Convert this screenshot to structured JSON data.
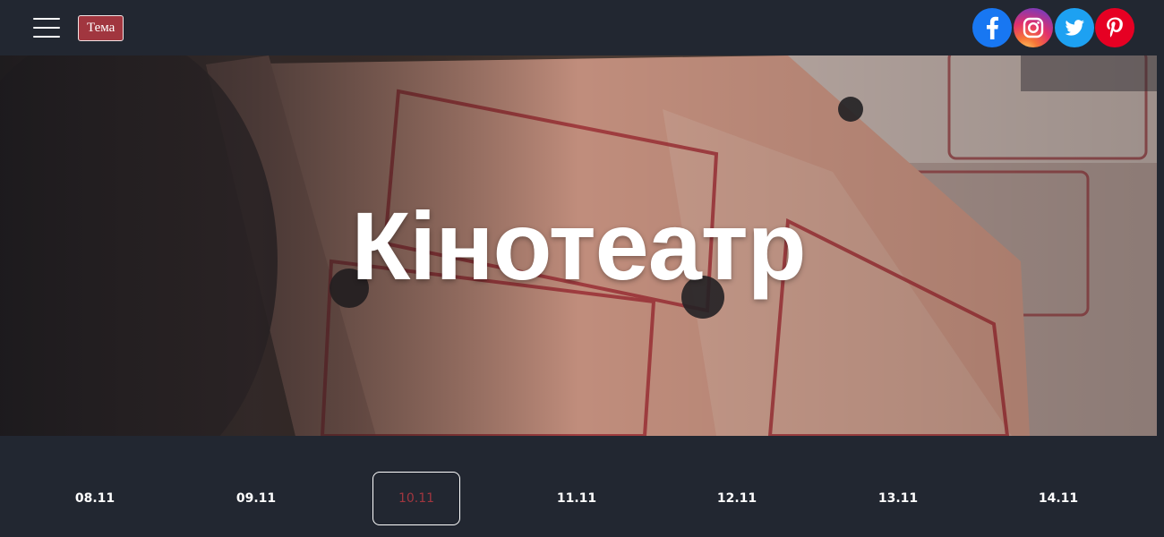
{
  "header": {
    "menu_icon": "hamburger-menu-icon",
    "theme_button_label": "Тема",
    "social": [
      {
        "name": "facebook",
        "icon": "facebook-icon",
        "color": "#1877f2"
      },
      {
        "name": "instagram",
        "icon": "instagram-icon",
        "color": "#e1306c"
      },
      {
        "name": "twitter",
        "icon": "twitter-icon",
        "color": "#1da1f2"
      },
      {
        "name": "pinterest",
        "icon": "pinterest-icon",
        "color": "#e60023"
      }
    ]
  },
  "hero": {
    "title": "Кінотеатр"
  },
  "dates": {
    "items": [
      "08.11",
      "09.11",
      "10.11",
      "11.11",
      "12.11",
      "13.11",
      "14.11"
    ],
    "active_index": 2
  },
  "colors": {
    "background": "#222731",
    "accent": "#a1363f"
  }
}
